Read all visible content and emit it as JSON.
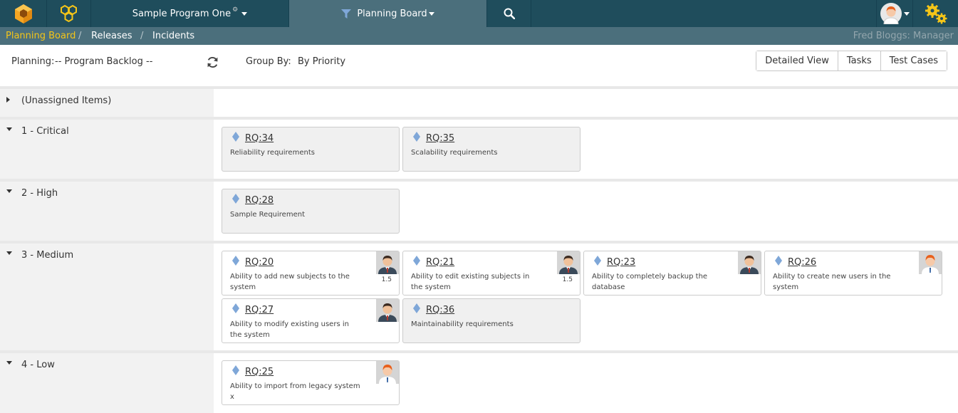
{
  "nav": {
    "program": "Sample Program One",
    "planning": "Planning Board"
  },
  "breadcrumb": {
    "items": [
      "Planning Board",
      "Releases",
      "Incidents"
    ],
    "separator": "/",
    "user": "Fred Bloggs: Manager"
  },
  "toolbar": {
    "planning_label": "Planning:",
    "planning_value": "-- Program Backlog --",
    "group_label": "Group By:",
    "group_value": "By Priority",
    "buttons": [
      "Detailed View",
      "Tasks",
      "Test Cases"
    ]
  },
  "rows": [
    {
      "label": "(Unassigned Items)",
      "expanded": false,
      "cards": []
    },
    {
      "label": "1 - Critical",
      "expanded": true,
      "cards": [
        {
          "id": "RQ:34",
          "desc": "Reliability requirements",
          "grey": true,
          "avatar": ""
        },
        {
          "id": "RQ:35",
          "desc": "Scalability requirements",
          "grey": true,
          "avatar": ""
        }
      ]
    },
    {
      "label": "2 - High",
      "expanded": true,
      "cards": [
        {
          "id": "RQ:28",
          "desc": "Sample Requirement",
          "grey": true,
          "avatar": ""
        }
      ]
    },
    {
      "label": "3 - Medium",
      "expanded": true,
      "cards": [
        {
          "id": "RQ:20",
          "desc": "Ability to add new subjects to the system",
          "grey": false,
          "avatar": "man",
          "est": "1.5"
        },
        {
          "id": "RQ:21",
          "desc": "Ability to edit existing subjects in the system",
          "grey": false,
          "avatar": "man",
          "est": "1.5"
        },
        {
          "id": "RQ:23",
          "desc": "Ability to completely backup the database",
          "grey": false,
          "avatar": "man"
        },
        {
          "id": "RQ:26",
          "desc": "Ability to create new users in the system",
          "grey": false,
          "avatar": "redhead"
        },
        {
          "id": "RQ:27",
          "desc": "Ability to modify existing users in the system",
          "grey": false,
          "avatar": "man"
        },
        {
          "id": "RQ:36",
          "desc": "Maintainability requirements",
          "grey": true,
          "avatar": ""
        }
      ]
    },
    {
      "label": "4 - Low",
      "expanded": true,
      "cards": [
        {
          "id": "RQ:25",
          "desc": "Ability to import from legacy system x",
          "grey": false,
          "avatar": "redhead"
        }
      ]
    }
  ],
  "colors": {
    "navbar": "#1f4d5c",
    "subbar": "#4b6f7c",
    "active_crumb": "#f5c518",
    "diamond": "#7fa7d8"
  }
}
